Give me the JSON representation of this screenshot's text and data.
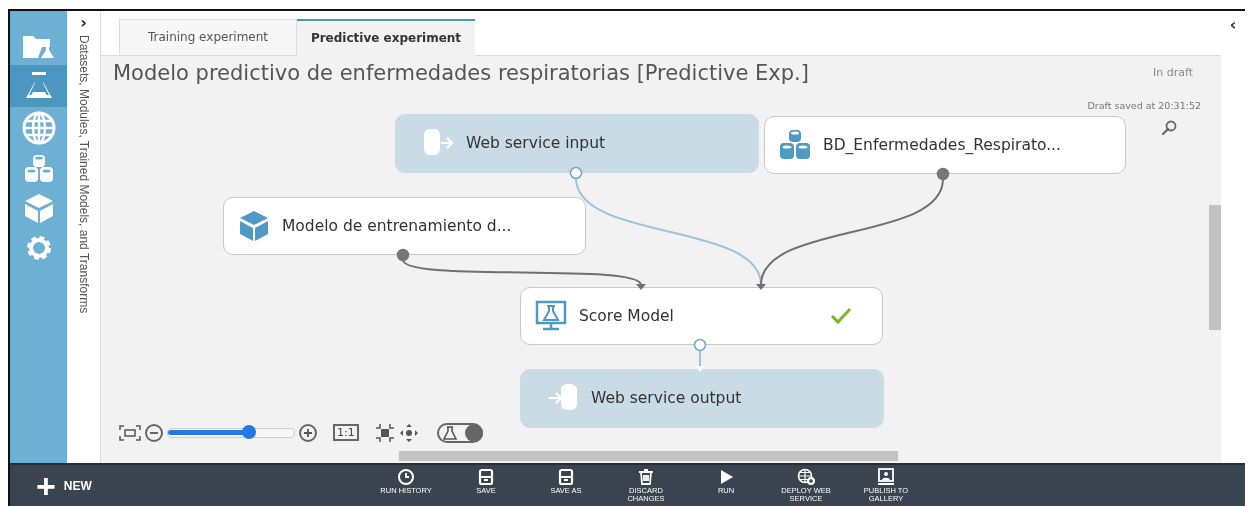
{
  "sidebar": {
    "items": [
      {
        "kind": "projects",
        "selected": false
      },
      {
        "kind": "experiments",
        "selected": true
      },
      {
        "kind": "web-services",
        "selected": false
      },
      {
        "kind": "datasets",
        "selected": false
      },
      {
        "kind": "models",
        "selected": false
      },
      {
        "kind": "settings",
        "selected": false
      }
    ]
  },
  "palette": {
    "toggle": "›",
    "title": "Datasets, Modules, Trained Models, and Transforms"
  },
  "tabs": [
    {
      "label": "Training experiment",
      "selected": false
    },
    {
      "label": "Predictive experiment",
      "selected": true
    }
  ],
  "experiment": {
    "title": "Modelo predictivo de enfermedades respiratorias [Predictive Exp.]",
    "status": "In draft",
    "saved": "Draft saved at 20:31:52"
  },
  "nodes": [
    {
      "kind": "web-input",
      "label": "Web service input",
      "done": false
    },
    {
      "kind": "dataset",
      "label": "BD_Enfermedades_Respirato...",
      "done": false
    },
    {
      "kind": "model",
      "label": "Modelo de entrenamiento d...",
      "done": false
    },
    {
      "kind": "score",
      "label": "Score Model",
      "done": true
    },
    {
      "kind": "web-output",
      "label": "Web service output",
      "done": false
    }
  ],
  "connections": [
    {
      "kind": "data"
    },
    {
      "kind": "web"
    },
    {
      "kind": "data"
    },
    {
      "kind": "web"
    }
  ],
  "zoom": {
    "level": 0.64,
    "actual_size": "1:1",
    "toggle_on": true
  },
  "right_panel": {
    "toggle": "‹"
  },
  "footer": {
    "new": {
      "icon": "+",
      "label": "NEW"
    },
    "actions": [
      {
        "kind": "history",
        "label": "RUN HISTORY"
      },
      {
        "kind": "save",
        "label": "SAVE"
      },
      {
        "kind": "save",
        "label": "SAVE AS"
      },
      {
        "kind": "trash",
        "label": "DISCARD CHANGES"
      },
      {
        "kind": "run",
        "label": "RUN"
      },
      {
        "kind": "deploy",
        "label": "DEPLOY WEB SERVICE"
      },
      {
        "kind": "publish",
        "label": "PUBLISH TO GALLERY"
      }
    ]
  }
}
